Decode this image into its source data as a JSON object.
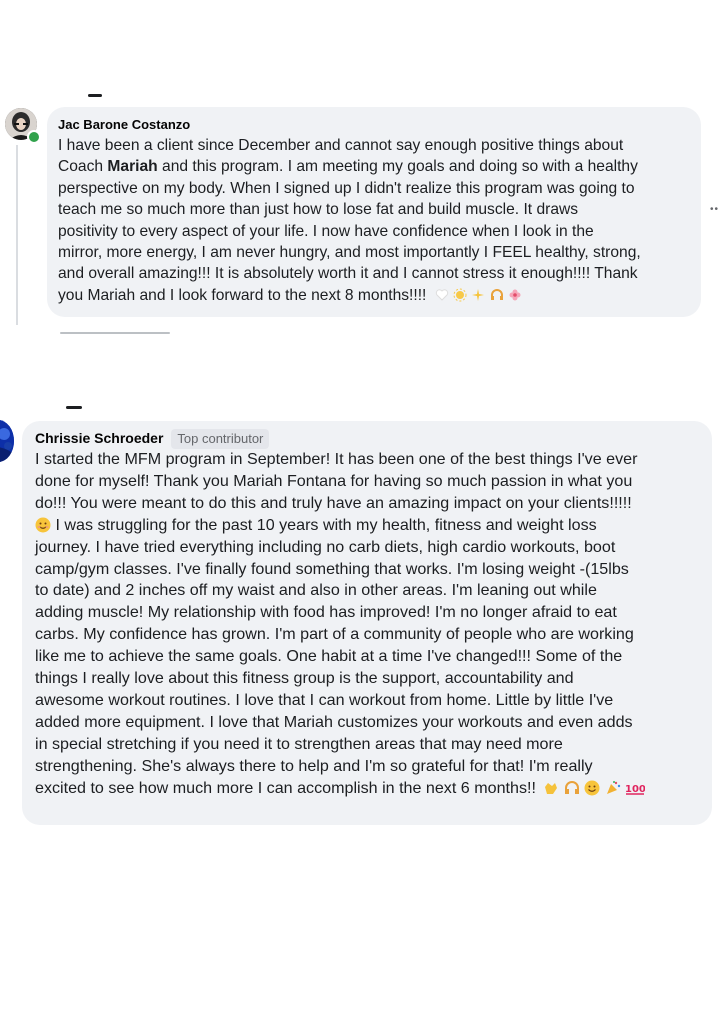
{
  "comments": [
    {
      "author": "Jac Barone Costanzo",
      "avatar_icon": "profile-photo-icon",
      "online": true,
      "lines": [
        "I have been a client since December and cannot say enough positive things about",
        "perspective on my body. When I signed up I didn't realize this program was going to",
        "teach me so much more than just how to lose fat and build muscle. It draws",
        "positivity to every aspect of your life. I now have confidence when I look in the",
        "mirror, more energy, I am never hungry, and most importantly I FEEL healthy, strong,",
        "and overall amazing!!! It is absolutely worth it and I cannot stress it enough!!!! Thank",
        "you Mariah and I look forward to the next 8 months!!!!"
      ],
      "line2_prefix": "Coach ",
      "line2_bold": "Mariah",
      "line2_suffix": " and this program. I am meeting my goals and doing so with a healthy",
      "emojis": [
        "white-heart-icon",
        "sun-icon",
        "sparkles-icon",
        "headphones-icon",
        "flower-icon"
      ]
    },
    {
      "author": "Chrissie Schroeder",
      "badge": "Top contributor",
      "avatar_icon": "profile-photo-icon",
      "lines": [
        "I started the MFM program in September! It has been one of the best things I've ever",
        "done for myself! Thank you Mariah Fontana for having so much passion in what you",
        "do!!! You were meant to do this and truly have an amazing impact on your clients!!!!!",
        " I was struggling for the past 10 years with my health, fitness and weight loss",
        "journey. I have tried everything including no carb diets, high cardio workouts, boot",
        "camp/gym classes. I've finally found something that works. I'm losing weight -(15lbs",
        "to date) and 2 inches off my waist and also in other areas. I'm leaning out while",
        "adding muscle! My relationship with food has improved! I'm no longer afraid to eat",
        "carbs. My confidence has grown. I'm part of a community of people who are working",
        "like me to achieve the same goals. One habit at a time I've changed!!! Some of the",
        "things I really love about this fitness group is the support, accountability and",
        "awesome workout routines. I love that I can workout from home. Little by little I've",
        "added more equipment. I love that Mariah customizes your workouts and even adds",
        "in special stretching if you need it to strengthen areas that may need more",
        "strengthening. She's always there to help and I'm so grateful for that! I'm really",
        "excited to see how much more I can accomplish in the next 6 months!!"
      ],
      "emojis": [
        "clapping-hands-icon",
        "headphones-icon",
        "smiley-face-icon",
        "party-popper-icon",
        "hundred-points-icon"
      ],
      "inline_emoji": "smiling-face-icon"
    }
  ],
  "colors": {
    "bubble": "#f0f2f5",
    "badge_bg": "#e4e6eb",
    "online": "#31a24c"
  }
}
